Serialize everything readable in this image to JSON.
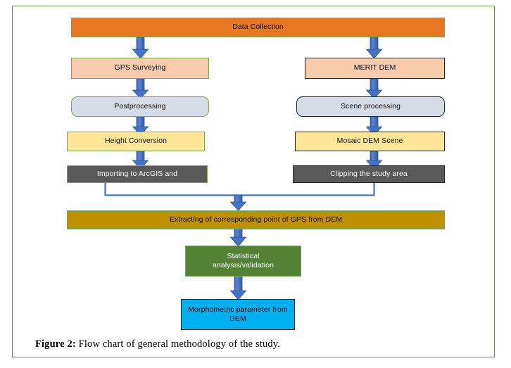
{
  "figure": {
    "caption_label": "Figure 2:",
    "caption_text": " Flow chart of general methodology of the study.",
    "frame_color": "#5d9040"
  },
  "palette": {
    "orange": "#e87722",
    "peach": "#f8cbad",
    "light_blue_gray": "#d6dce4",
    "light_yellow": "#ffe699",
    "dark_gray": "#595959",
    "gold": "#bf9000",
    "green": "#548235",
    "cyan": "#00b0f0",
    "border_green": "#70ad47",
    "border_dark": "#262626",
    "arrow_blue": "#4472c4",
    "arrow_blue_edge": "#2e5496"
  },
  "chart_data": {
    "type": "diagram",
    "title": "Flow chart of general methodology of the study",
    "nodes": [
      {
        "id": "data-collection",
        "label": "Data Collection",
        "fill": "#e87722",
        "border": "green",
        "shape": "rect"
      },
      {
        "id": "gps-surveying",
        "label": "GPS Surveying",
        "fill": "#f8cbad",
        "border": "green",
        "shape": "rect"
      },
      {
        "id": "merit-dem",
        "label": "MERIT DEM",
        "fill": "#f8cbad",
        "border": "dark",
        "shape": "rect"
      },
      {
        "id": "postprocessing",
        "label": "Postprocessing",
        "fill": "#d6dce4",
        "border": "green",
        "shape": "rounded"
      },
      {
        "id": "scene-processing",
        "label": "Scene processing",
        "fill": "#d6dce4",
        "border": "dark",
        "shape": "rounded"
      },
      {
        "id": "height-conversion",
        "label": "Height Conversion",
        "fill": "#ffe699",
        "border": "green",
        "shape": "rect"
      },
      {
        "id": "mosaic-dem-scene",
        "label": "Mosaic DEM Scene",
        "fill": "#ffe699",
        "border": "dark",
        "shape": "rect"
      },
      {
        "id": "importing-arcgis",
        "label": "Importing to ArcGIS and",
        "fill": "#595959",
        "border": "green",
        "shape": "rect"
      },
      {
        "id": "clipping-study",
        "label": "Clipping the study area",
        "fill": "#595959",
        "border": "dark",
        "shape": "rect"
      },
      {
        "id": "extracting-point",
        "label": "Extracting of corresponding point of GPS from DEM",
        "fill": "#bf9000",
        "border": "green",
        "shape": "rect"
      },
      {
        "id": "statistical",
        "label": "Statistical analysis/validation",
        "fill": "#548235",
        "border": "green",
        "shape": "rect"
      },
      {
        "id": "morphometric",
        "label": "Morphometric parameter from DEM",
        "fill": "#00b0f0",
        "border": "dark",
        "shape": "rect"
      }
    ],
    "edges": [
      {
        "from": "data-collection",
        "to": "gps-surveying"
      },
      {
        "from": "data-collection",
        "to": "merit-dem"
      },
      {
        "from": "gps-surveying",
        "to": "postprocessing"
      },
      {
        "from": "merit-dem",
        "to": "scene-processing"
      },
      {
        "from": "postprocessing",
        "to": "height-conversion"
      },
      {
        "from": "scene-processing",
        "to": "mosaic-dem-scene"
      },
      {
        "from": "height-conversion",
        "to": "importing-arcgis"
      },
      {
        "from": "mosaic-dem-scene",
        "to": "clipping-study"
      },
      {
        "from": "importing-arcgis",
        "to": "extracting-point"
      },
      {
        "from": "clipping-study",
        "to": "extracting-point"
      },
      {
        "from": "extracting-point",
        "to": "statistical"
      },
      {
        "from": "statistical",
        "to": "morphometric"
      }
    ]
  },
  "nodes": {
    "data_collection": "Data Collection",
    "gps_surveying": "GPS Surveying",
    "merit_dem": "MERIT DEM",
    "postprocessing": "Postprocessing",
    "scene_processing": "Scene processing",
    "height_conversion": "Height Conversion",
    "mosaic_dem_scene": "Mosaic DEM Scene",
    "importing_arcgis": "Importing to ArcGIS and",
    "clipping_study_area": "Clipping the study area",
    "extracting_point": "Extracting of corresponding point of GPS from DEM",
    "statistical_line1": "Statistical",
    "statistical_line2": "analysis/validation",
    "morphometric_line1": "Morphometric parameter from",
    "morphometric_line2": "DEM"
  }
}
